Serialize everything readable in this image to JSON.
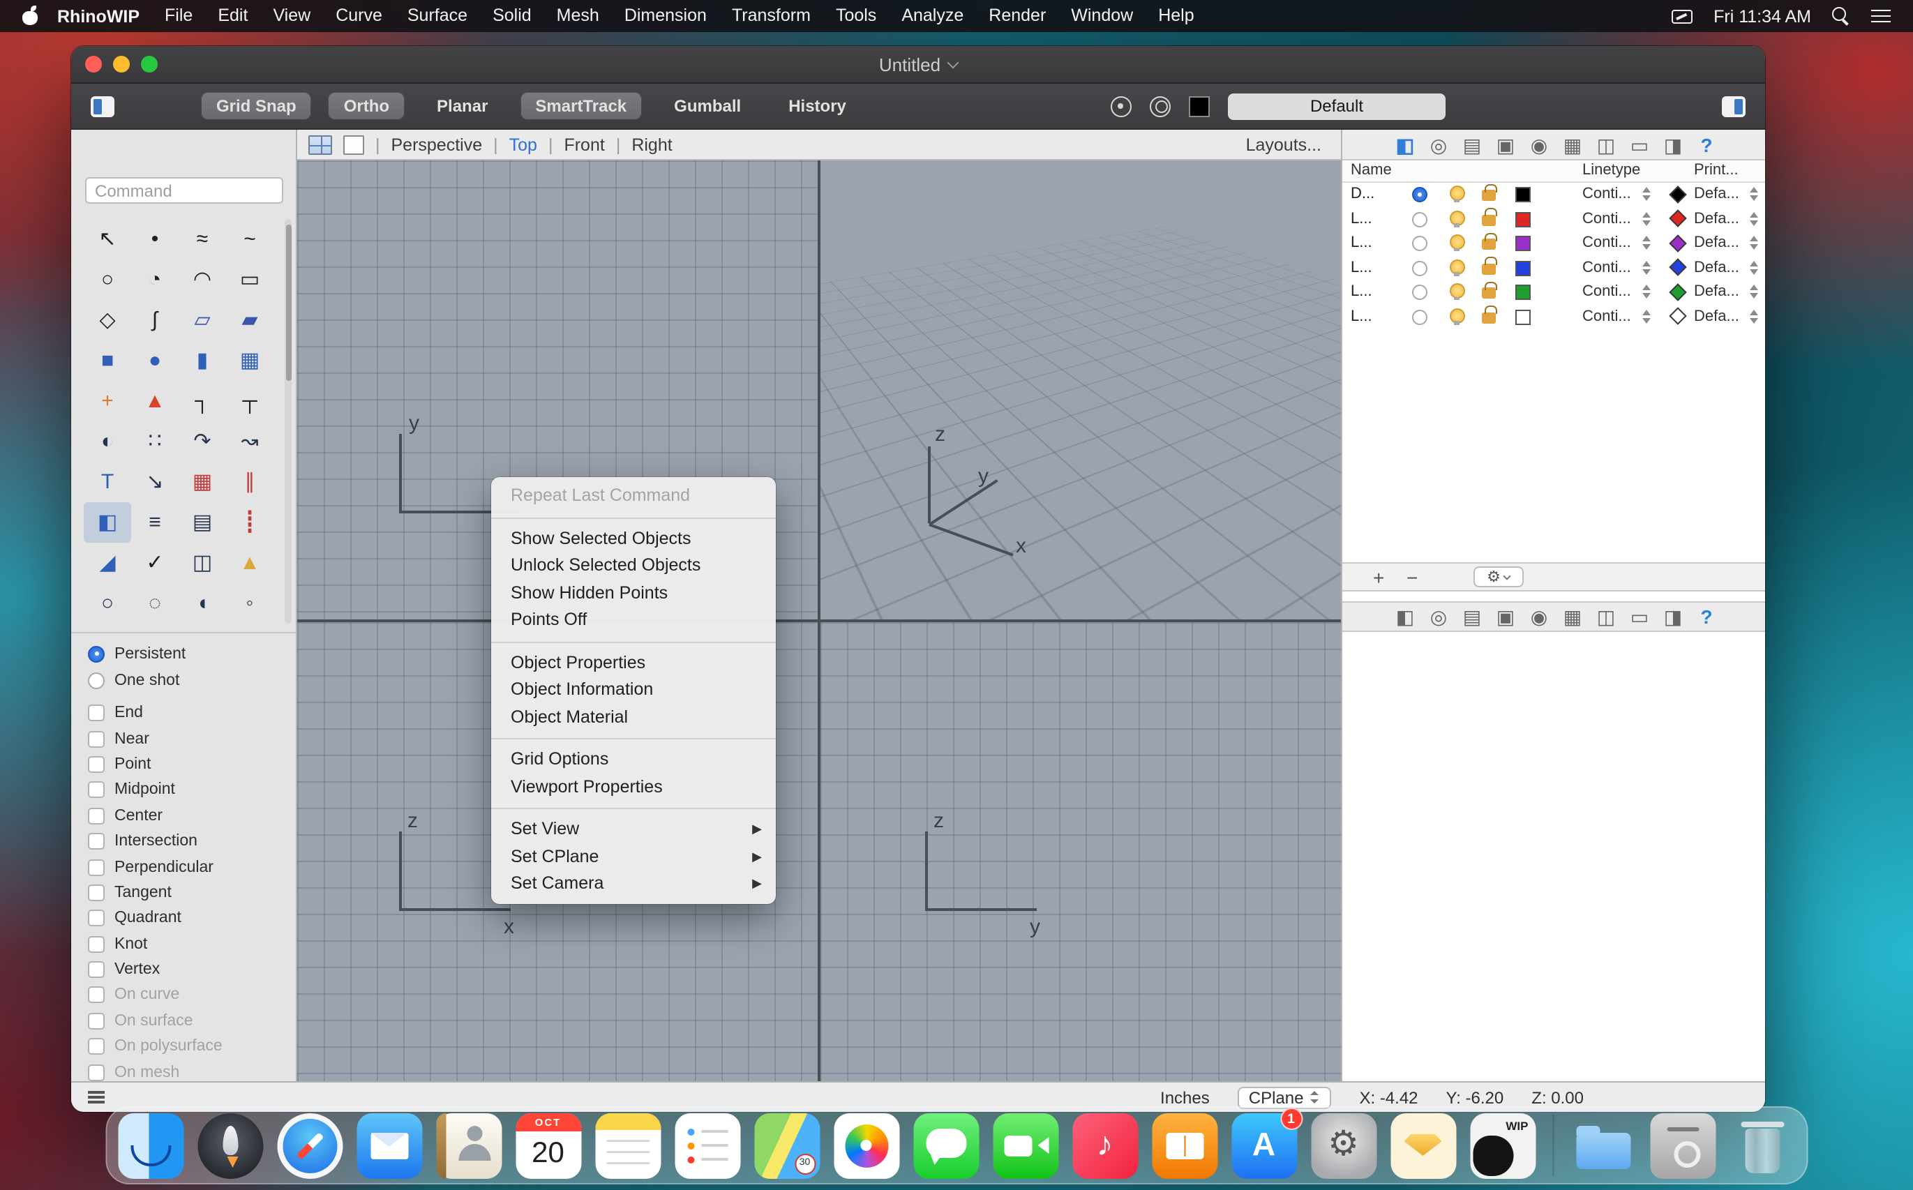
{
  "menubar": {
    "app_name": "RhinoWIP",
    "items": [
      "File",
      "Edit",
      "View",
      "Curve",
      "Surface",
      "Solid",
      "Mesh",
      "Dimension",
      "Transform",
      "Tools",
      "Analyze",
      "Render",
      "Window",
      "Help"
    ],
    "clock": "Fri 11:34 AM"
  },
  "window": {
    "title": "Untitled"
  },
  "toolbar": {
    "buttons": [
      {
        "label": "Grid Snap",
        "active": true
      },
      {
        "label": "Ortho",
        "active": true
      },
      {
        "label": "Planar",
        "active": false
      },
      {
        "label": "SmartTrack",
        "active": true
      },
      {
        "label": "Gumball",
        "active": false
      },
      {
        "label": "History",
        "active": false
      }
    ],
    "profile": "Default"
  },
  "left_panel": {
    "command_placeholder": "Command"
  },
  "tool_palette": {
    "icons": [
      {
        "name": "select",
        "glyph": "↖",
        "color": "#1f1f1f"
      },
      {
        "name": "point",
        "glyph": "•",
        "color": "#1f1f1f"
      },
      {
        "name": "curve",
        "glyph": "≈",
        "color": "#1f1f1f"
      },
      {
        "name": "curve-through-points",
        "glyph": "~",
        "color": "#1f1f1f"
      },
      {
        "name": "circle",
        "glyph": "○",
        "color": "#1f1f1f"
      },
      {
        "name": "ellipse",
        "glyph": "◔",
        "color": "#1f1f1f"
      },
      {
        "name": "arc",
        "glyph": "◠",
        "color": "#1f1f1f"
      },
      {
        "name": "rectangle",
        "glyph": "▭",
        "color": "#1f1f1f"
      },
      {
        "name": "polygon",
        "glyph": "◇",
        "color": "#1f1f1f"
      },
      {
        "name": "freeform-curve",
        "glyph": "∫",
        "color": "#1f1f1f"
      },
      {
        "name": "surface-from-curves",
        "glyph": "▱",
        "color": "#3a56a8"
      },
      {
        "name": "surface-corner",
        "glyph": "▰",
        "color": "#3a56a8"
      },
      {
        "name": "box",
        "glyph": "■",
        "color": "#2f5fb8"
      },
      {
        "name": "sphere",
        "glyph": "●",
        "color": "#2f5fb8"
      },
      {
        "name": "cylinder",
        "glyph": "▮",
        "color": "#2f5fb8"
      },
      {
        "name": "surface-plane",
        "glyph": "▦",
        "color": "#2f5fb8"
      },
      {
        "name": "plugins",
        "glyph": "+",
        "color": "#e07b2a"
      },
      {
        "name": "gradient-hatch",
        "glyph": "▲",
        "color": "#d8452a"
      },
      {
        "name": "fillet",
        "glyph": "┐",
        "color": "#1f1f1f"
      },
      {
        "name": "chamfer",
        "glyph": "┬",
        "color": "#1f1f1f"
      },
      {
        "name": "boolean",
        "glyph": "◐",
        "color": "#27364f"
      },
      {
        "name": "point-cloud",
        "glyph": "∷",
        "color": "#27364f"
      },
      {
        "name": "blend-curve",
        "glyph": "↷",
        "color": "#27364f"
      },
      {
        "name": "rebuild",
        "glyph": "↝",
        "color": "#27364f"
      },
      {
        "name": "text",
        "glyph": "T",
        "color": "#2f5fb8"
      },
      {
        "name": "move",
        "glyph": "↘",
        "color": "#27364f"
      },
      {
        "name": "copy",
        "glyph": "▦",
        "color": "#c23a3a"
      },
      {
        "name": "linear-array",
        "glyph": "∥",
        "color": "#c23a3a"
      },
      {
        "name": "box-edit",
        "glyph": "◧",
        "color": "#2f5fb8"
      },
      {
        "name": "align",
        "glyph": "≡",
        "color": "#27364f"
      },
      {
        "name": "grid-array",
        "glyph": "▤",
        "color": "#27364f"
      },
      {
        "name": "vertical-array",
        "glyph": "┋",
        "color": "#c23a3a"
      },
      {
        "name": "trim",
        "glyph": "◢",
        "color": "#2f5fb8"
      },
      {
        "name": "check",
        "glyph": "✓",
        "color": "#1f1f1f"
      },
      {
        "name": "cage-edit",
        "glyph": "◫",
        "color": "#27364f"
      },
      {
        "name": "cone",
        "glyph": "▲",
        "color": "#d9a93c"
      },
      {
        "name": "divide",
        "glyph": "○",
        "color": "#27364f"
      },
      {
        "name": "osnap-dots",
        "glyph": "◌",
        "color": "#27364f"
      },
      {
        "name": "ellipsoid",
        "glyph": "◖",
        "color": "#27364f"
      },
      {
        "name": "misc",
        "glyph": "◦",
        "color": "#27364f"
      }
    ]
  },
  "osnap": {
    "modes": [
      {
        "label": "Persistent",
        "selected": true
      },
      {
        "label": "One shot",
        "selected": false
      }
    ],
    "snaps": [
      {
        "label": "End"
      },
      {
        "label": "Near"
      },
      {
        "label": "Point"
      },
      {
        "label": "Midpoint"
      },
      {
        "label": "Center"
      },
      {
        "label": "Intersection"
      },
      {
        "label": "Perpendicular"
      },
      {
        "label": "Tangent"
      },
      {
        "label": "Quadrant"
      },
      {
        "label": "Knot"
      },
      {
        "label": "Vertex"
      },
      {
        "label": "On curve",
        "muted": true
      },
      {
        "label": "On surface",
        "muted": true
      },
      {
        "label": "On polysurface",
        "muted": true
      },
      {
        "label": "On mesh",
        "muted": true
      }
    ]
  },
  "viewport_tabs": {
    "separator": "|",
    "tabs": [
      {
        "label": "Perspective",
        "active": false
      },
      {
        "label": "Top",
        "active": true
      },
      {
        "label": "Front",
        "active": false
      },
      {
        "label": "Right",
        "active": false
      }
    ],
    "layouts": "Layouts..."
  },
  "viewports": {
    "top": {
      "y": "y"
    },
    "perspective": {
      "z": "z",
      "y": "y",
      "x": "x"
    },
    "front": {
      "z": "z",
      "x": "x"
    },
    "right": {
      "z": "z",
      "y": "y"
    },
    "bg_color": "#9ba3af"
  },
  "context_menu": {
    "items": [
      {
        "label": "Repeat Last Command",
        "disabled": true
      },
      {
        "sep": true
      },
      {
        "label": "Show Selected Objects"
      },
      {
        "label": "Unlock Selected Objects"
      },
      {
        "label": "Show Hidden Points"
      },
      {
        "label": "Points Off"
      },
      {
        "sep": true
      },
      {
        "label": "Object Properties"
      },
      {
        "label": "Object Information"
      },
      {
        "label": "Object Material"
      },
      {
        "sep": true
      },
      {
        "label": "Grid Options"
      },
      {
        "label": "Viewport Properties"
      },
      {
        "sep": true
      },
      {
        "label": "Set View",
        "submenu": true
      },
      {
        "label": "Set CPlane",
        "submenu": true
      },
      {
        "label": "Set Camera",
        "submenu": true
      }
    ],
    "submenu_arrow": "▶"
  },
  "panel_icons": [
    {
      "name": "layers",
      "glyph": "◧",
      "blue": true
    },
    {
      "name": "properties",
      "glyph": "◎"
    },
    {
      "name": "notes",
      "glyph": "▤"
    },
    {
      "name": "materials",
      "glyph": "▣"
    },
    {
      "name": "camera",
      "glyph": "◉"
    },
    {
      "name": "mesh",
      "glyph": "▦"
    },
    {
      "name": "sheets",
      "glyph": "◫"
    },
    {
      "name": "frame",
      "glyph": "▭"
    },
    {
      "name": "display",
      "glyph": "◨"
    },
    {
      "name": "help",
      "glyph": "?",
      "blue": true
    }
  ],
  "layers": {
    "columns": [
      "Name",
      "Linetype",
      "Print..."
    ],
    "rows": [
      {
        "name": "D...",
        "color": "#000000",
        "linetype": "Conti...",
        "print": "Defa...",
        "current": true
      },
      {
        "name": "L...",
        "color": "#e02525",
        "linetype": "Conti...",
        "print": "Defa..."
      },
      {
        "name": "L...",
        "color": "#9a30c9",
        "linetype": "Conti...",
        "print": "Defa..."
      },
      {
        "name": "L...",
        "color": "#2441e0",
        "linetype": "Conti...",
        "print": "Defa..."
      },
      {
        "name": "L...",
        "color": "#1e9e2e",
        "linetype": "Conti...",
        "print": "Defa..."
      },
      {
        "name": "L...",
        "color": "#ffffff",
        "linetype": "Conti...",
        "print": "Defa..."
      }
    ]
  },
  "panel_controls": {
    "add": "+",
    "remove": "−",
    "gear": "⚙"
  },
  "status": {
    "units": "Inches",
    "cplane": "CPlane",
    "x": "X: -4.42",
    "y": "Y: -6.20",
    "z": "Z: 0.00"
  },
  "dock": {
    "items": [
      "finder",
      "launchpad",
      "safari",
      "mail",
      "contacts",
      "calendar",
      "notes",
      "reminders",
      "maps",
      "photos",
      "messages",
      "facetime",
      "music",
      "books",
      "app-store",
      "system-preferences",
      "sketch",
      "rhino-wip",
      "applications-folder",
      "disk-image",
      "trash"
    ],
    "calendar_month": "OCT",
    "calendar_day": "20",
    "maps_badge": "30",
    "appstore_badge": "1",
    "music_glyph": "♪",
    "appstore_glyph": "A",
    "sysprefs_glyph": "⚙",
    "wip_label": "WIP"
  },
  "colors": {
    "selection_blue": "#1e63d6",
    "viewport_bg": "#9ba3af",
    "toolbar_swatch": "#000000"
  }
}
